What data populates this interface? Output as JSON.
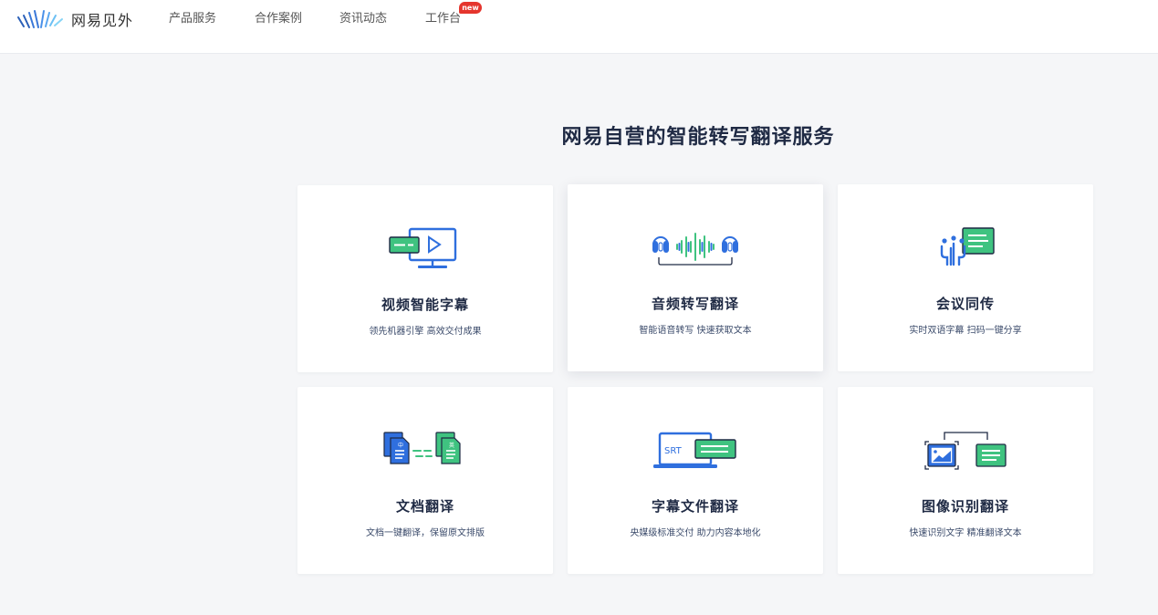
{
  "header": {
    "logo_text": "网易见外",
    "nav": [
      {
        "label": "产品服务"
      },
      {
        "label": "合作案例"
      },
      {
        "label": "资讯动态"
      },
      {
        "label": "工作台",
        "badge": "new"
      }
    ]
  },
  "main": {
    "title": "网易自营的智能转写翻译服务",
    "cards": [
      {
        "title": "视频智能字幕",
        "desc": "领先机器引擎 高效交付成果",
        "icon": "video-subtitle-icon"
      },
      {
        "title": "音频转写翻译",
        "desc": "智能语音转写 快速获取文本",
        "icon": "audio-transcribe-icon"
      },
      {
        "title": "会议同传",
        "desc": "实时双语字幕 扫码一键分享",
        "icon": "meeting-interpret-icon"
      },
      {
        "title": "文档翻译",
        "desc": "文档一键翻译，保留原文排版",
        "icon": "document-translate-icon"
      },
      {
        "title": "字幕文件翻译",
        "desc": "央媒级标准交付 助力内容本地化",
        "icon": "subtitle-file-icon",
        "icon_text": "SRT"
      },
      {
        "title": "图像识别翻译",
        "desc": "快速识别文字 精准翻译文本",
        "icon": "image-recognition-icon"
      }
    ]
  },
  "colors": {
    "brand_blue": "#2f6fde",
    "accent_green": "#3fc380",
    "dark_navy": "#1f2a44",
    "badge_red": "#e5352d"
  }
}
